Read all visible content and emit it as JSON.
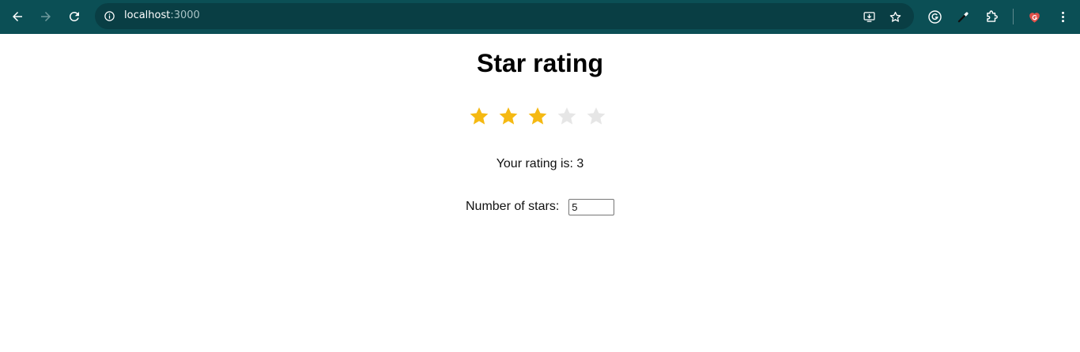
{
  "browser": {
    "url_host": "localhost",
    "url_port": ":3000",
    "icons": [
      "back-arrow-icon",
      "forward-arrow-icon",
      "reload-icon",
      "site-info-icon",
      "install-app-icon",
      "bookmark-star-icon",
      "grammarly-icon",
      "eyedropper-icon",
      "extensions-puzzle-icon",
      "profile-icon",
      "more-menu-icon"
    ],
    "colors": {
      "toolbar": "#0b4f55",
      "omnibox": "#093e44"
    }
  },
  "page": {
    "title": "Star rating",
    "rating_text": "Your rating is: 3",
    "rating": {
      "value": 3,
      "max": 5
    },
    "stars_label": "Number of stars:",
    "stars_input_value": "5",
    "colors": {
      "star_filled": "#f5b912",
      "star_empty": "#e6e6e6"
    }
  }
}
